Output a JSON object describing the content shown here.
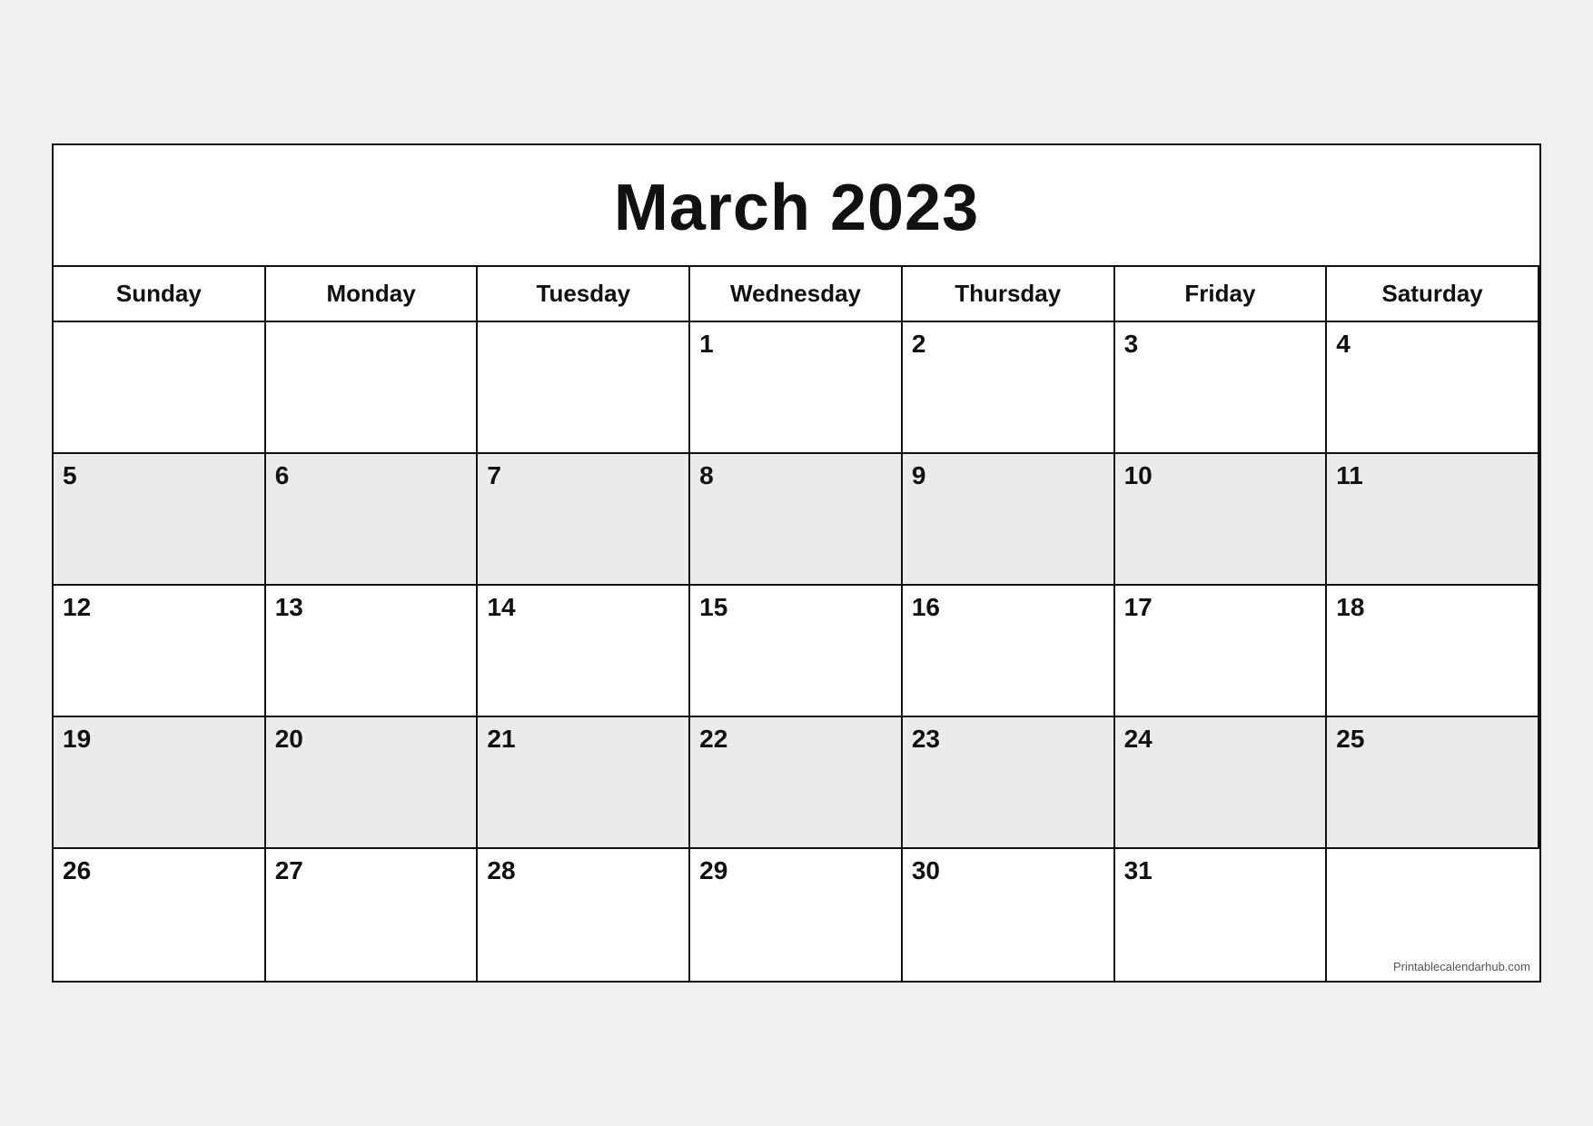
{
  "calendar": {
    "title": "March 2023",
    "headers": [
      "Sunday",
      "Monday",
      "Tuesday",
      "Wednesday",
      "Thursday",
      "Friday",
      "Saturday"
    ],
    "weeks": [
      [
        {
          "day": "",
          "empty": true,
          "shaded": false
        },
        {
          "day": "",
          "empty": true,
          "shaded": false
        },
        {
          "day": "",
          "empty": true,
          "shaded": false
        },
        {
          "day": "1",
          "shaded": false
        },
        {
          "day": "2",
          "shaded": false
        },
        {
          "day": "3",
          "shaded": false
        },
        {
          "day": "4",
          "shaded": false
        }
      ],
      [
        {
          "day": "5",
          "shaded": true,
          "bold": true
        },
        {
          "day": "6",
          "shaded": true
        },
        {
          "day": "7",
          "shaded": true
        },
        {
          "day": "8",
          "shaded": true
        },
        {
          "day": "9",
          "shaded": true
        },
        {
          "day": "10",
          "shaded": true
        },
        {
          "day": "11",
          "shaded": true
        }
      ],
      [
        {
          "day": "12",
          "shaded": false,
          "bold": true
        },
        {
          "day": "13",
          "shaded": false
        },
        {
          "day": "14",
          "shaded": false
        },
        {
          "day": "15",
          "shaded": false
        },
        {
          "day": "16",
          "shaded": false
        },
        {
          "day": "17",
          "shaded": false
        },
        {
          "day": "18",
          "shaded": false
        }
      ],
      [
        {
          "day": "19",
          "shaded": true,
          "bold": true
        },
        {
          "day": "20",
          "shaded": true
        },
        {
          "day": "21",
          "shaded": true
        },
        {
          "day": "22",
          "shaded": true
        },
        {
          "day": "23",
          "shaded": true
        },
        {
          "day": "24",
          "shaded": true
        },
        {
          "day": "25",
          "shaded": true
        }
      ],
      [
        {
          "day": "26",
          "shaded": false,
          "bold": true
        },
        {
          "day": "27",
          "shaded": false
        },
        {
          "day": "28",
          "shaded": false
        },
        {
          "day": "29",
          "shaded": false
        },
        {
          "day": "30",
          "shaded": false
        },
        {
          "day": "31",
          "shaded": false
        },
        {
          "day": "",
          "empty": true,
          "shaded": false,
          "watermark": "Printablecalendarhub.com"
        }
      ]
    ],
    "watermark": "Printablecalendarhub.com"
  }
}
